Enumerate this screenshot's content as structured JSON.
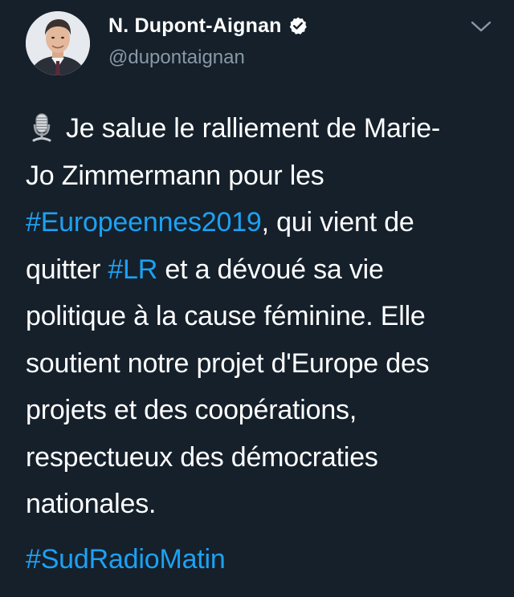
{
  "author": {
    "display_name": "N. Dupont-Aignan",
    "handle": "@dupontaignan",
    "verified": true,
    "avatar_icon": "profile-photo"
  },
  "tweet": {
    "mic_icon": "studio-microphone-icon",
    "line1": "Je salue le ralliement de Marie-",
    "line2": "Jo Zimmermann pour les",
    "hashtag_europeennes": "#Europeennes2019",
    "line3_rest": ", qui vient de",
    "line4_pre": "quitter ",
    "hashtag_lr": "#LR",
    "line4_rest": " et a dévoué sa vie",
    "line5": "politique à la cause féminine. Elle",
    "line6": "soutient notre projet d'Europe des",
    "line7": "projets et des coopérations,",
    "line8": "respectueux des démocraties",
    "line9": "nationales.",
    "hashtag_sudradio": "#SudRadioMatin"
  },
  "colors": {
    "background": "#15202b",
    "text": "#ffffff",
    "secondary": "#8899a6",
    "link": "#1da1f2"
  }
}
